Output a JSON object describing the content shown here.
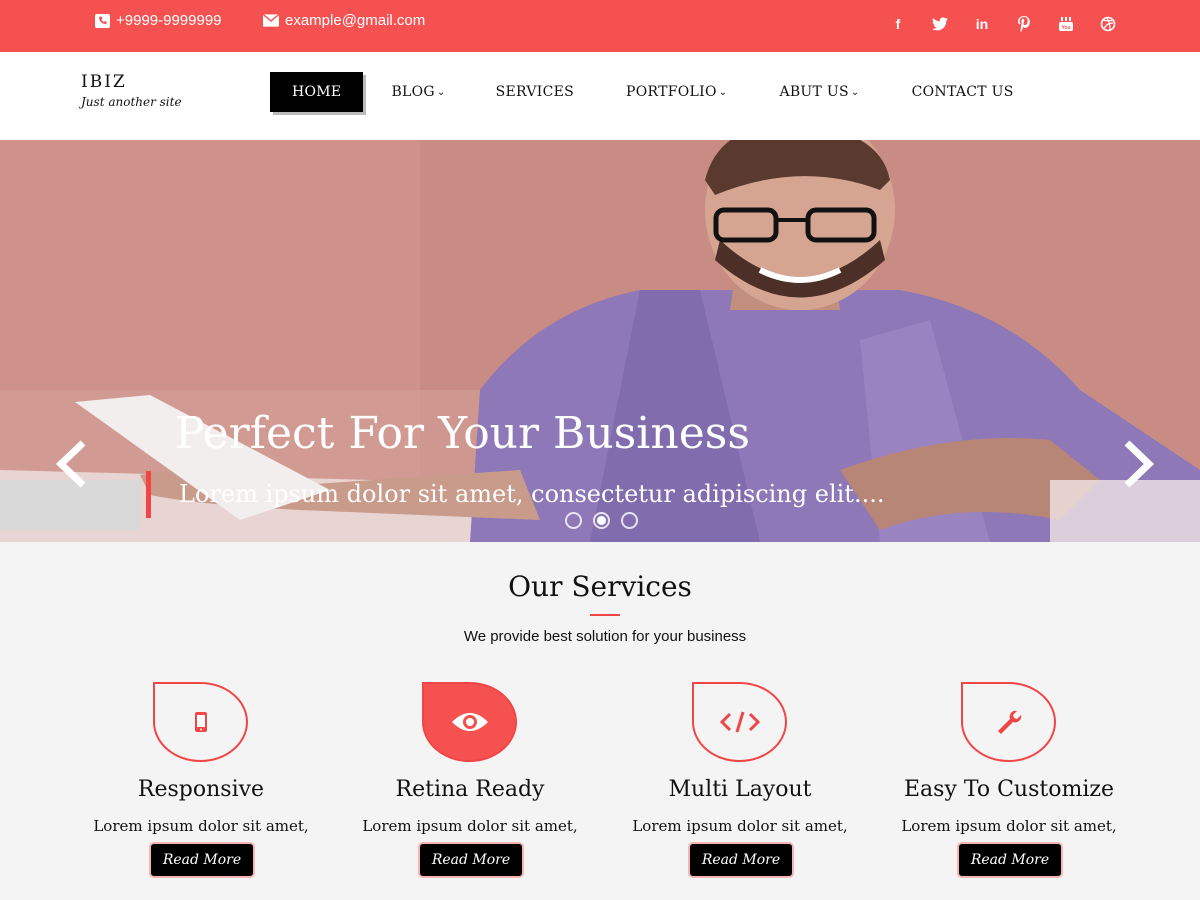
{
  "topbar": {
    "phone": "+9999-9999999",
    "email": "example@gmail.com",
    "social": [
      "facebook",
      "twitter",
      "linkedin",
      "pinterest",
      "youtube",
      "dribbble"
    ],
    "bg_color": "#f55151"
  },
  "header": {
    "site_name": "IBIZ",
    "tagline": "Just another site",
    "nav": [
      {
        "label": "HOME"
      },
      {
        "label": "BLOG"
      },
      {
        "label": "SERVICES"
      },
      {
        "label": "PORTFOLIO"
      },
      {
        "label": "ABUT US"
      },
      {
        "label": "CONTACT US"
      }
    ]
  },
  "hero": {
    "title": "Perfect For Your Business",
    "subtitle": "Lorem ipsum dolor sit amet, consectetur adipiscing elit....",
    "slide_count": 3,
    "active_slide": 2
  },
  "services": {
    "heading": "Our Services",
    "lead": "We provide best solution for your business",
    "cards": [
      {
        "title": "Responsive",
        "text": "Lorem ipsum dolor sit amet,",
        "button": "Read More",
        "icon": "mobile-icon"
      },
      {
        "title": "Retina Ready",
        "text": "Lorem ipsum dolor sit amet,",
        "button": "Read More",
        "icon": "eye-icon"
      },
      {
        "title": "Multi Layout",
        "text": "Lorem ipsum dolor sit amet,",
        "button": "Read More",
        "icon": "code-icon"
      },
      {
        "title": "Easy To Customize",
        "text": "Lorem ipsum dolor sit amet,",
        "button": "Read More",
        "icon": "wrench-icon"
      }
    ]
  },
  "colors": {
    "accent": "#f55151",
    "dark": "#000000"
  }
}
